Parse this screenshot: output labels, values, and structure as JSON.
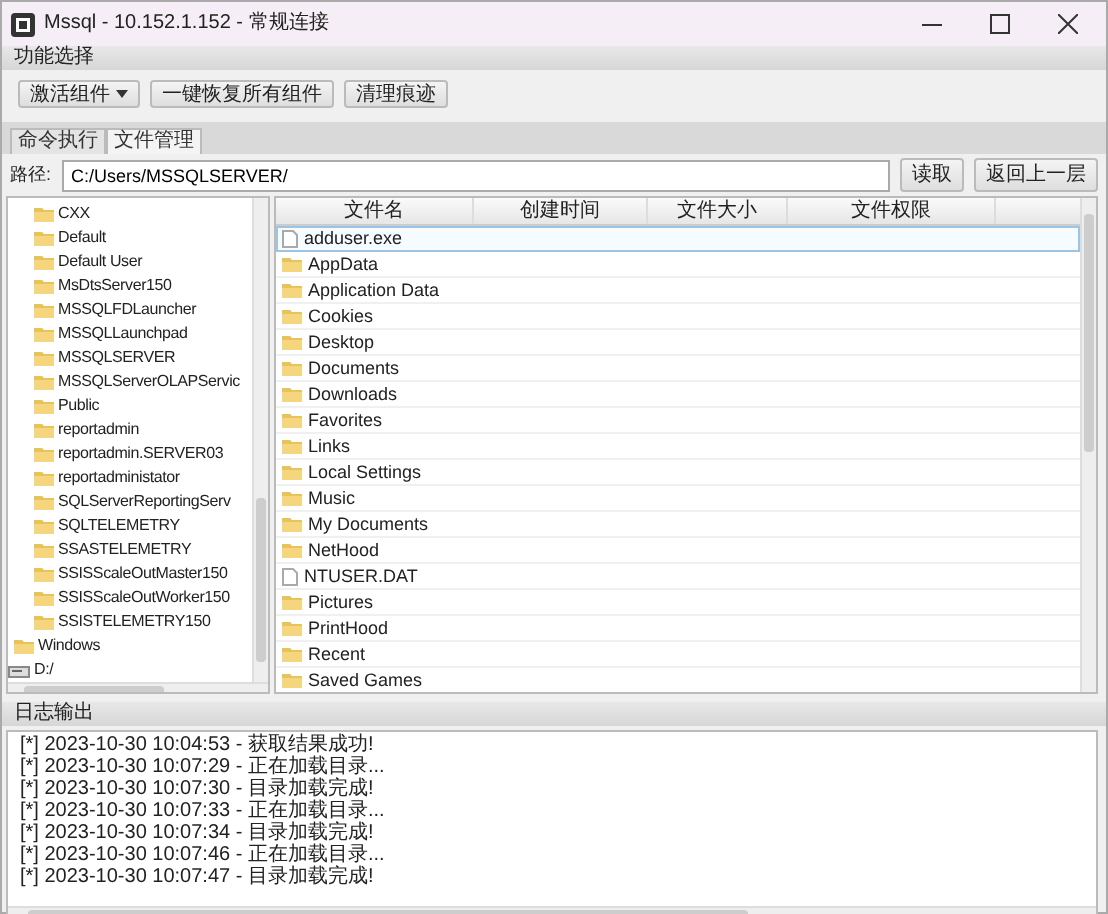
{
  "window": {
    "title": "Mssql - 10.152.1.152 - 常规连接"
  },
  "function_panel": {
    "title": "功能选择",
    "buttons": [
      {
        "label": "激活组件",
        "kind": "dropdown"
      },
      {
        "label": "一键恢复所有组件",
        "kind": "button"
      },
      {
        "label": "清理痕迹",
        "kind": "button"
      }
    ]
  },
  "tabs": [
    {
      "label": "命令执行",
      "selected": false
    },
    {
      "label": "文件管理",
      "selected": true
    }
  ],
  "path_bar": {
    "label": "路径:",
    "value": "C:/Users/MSSQLSERVER/",
    "buttons": [
      "读取",
      "返回上一层"
    ]
  },
  "tree": [
    {
      "children": [
        {
          "children": [
            {
              "label": "CXX",
              "kind": "folder"
            },
            {
              "label": "Default",
              "kind": "folder"
            },
            {
              "label": "Default User",
              "kind": "folder"
            },
            {
              "label": "MsDtsServer150",
              "kind": "folder"
            },
            {
              "label": "MSSQLFDLauncher",
              "kind": "folder"
            },
            {
              "label": "MSSQLLaunchpad",
              "kind": "folder"
            },
            {
              "label": "MSSQLSERVER",
              "kind": "folder"
            },
            {
              "label": "MSSQLServerOLAPServic",
              "kind": "folder"
            },
            {
              "label": "Public",
              "kind": "folder"
            },
            {
              "label": "reportadmin",
              "kind": "folder"
            },
            {
              "label": "reportadmin.SERVER03",
              "kind": "folder"
            },
            {
              "label": "reportadministator",
              "kind": "folder"
            },
            {
              "label": "SQLServerReportingServ",
              "kind": "folder"
            },
            {
              "label": "SQLTELEMETRY",
              "kind": "folder"
            },
            {
              "label": "SSASTELEMETRY",
              "kind": "folder"
            },
            {
              "label": "SSISScaleOutMaster150",
              "kind": "folder"
            },
            {
              "label": "SSISScaleOutWorker150",
              "kind": "folder"
            },
            {
              "label": "SSISTELEMETRY150",
              "kind": "folder"
            }
          ]
        },
        {
          "label": "Windows",
          "kind": "folder"
        }
      ]
    },
    {
      "label": "D:/",
      "kind": "drive"
    }
  ],
  "table": {
    "columns": [
      "文件名",
      "创建时间",
      "文件大小",
      "文件权限"
    ],
    "rows": [
      {
        "name": "adduser.exe",
        "kind": "file",
        "selected": true
      },
      {
        "name": "AppData",
        "kind": "folder",
        "selected": false
      },
      {
        "name": "Application Data",
        "kind": "folder",
        "selected": false
      },
      {
        "name": "Cookies",
        "kind": "folder",
        "selected": false
      },
      {
        "name": "Desktop",
        "kind": "folder",
        "selected": false
      },
      {
        "name": "Documents",
        "kind": "folder",
        "selected": false
      },
      {
        "name": "Downloads",
        "kind": "folder",
        "selected": false
      },
      {
        "name": "Favorites",
        "kind": "folder",
        "selected": false
      },
      {
        "name": "Links",
        "kind": "folder",
        "selected": false
      },
      {
        "name": "Local Settings",
        "kind": "folder",
        "selected": false
      },
      {
        "name": "Music",
        "kind": "folder",
        "selected": false
      },
      {
        "name": "My Documents",
        "kind": "folder",
        "selected": false
      },
      {
        "name": "NetHood",
        "kind": "folder",
        "selected": false
      },
      {
        "name": "NTUSER.DAT",
        "kind": "file",
        "selected": false
      },
      {
        "name": "Pictures",
        "kind": "folder",
        "selected": false
      },
      {
        "name": "PrintHood",
        "kind": "folder",
        "selected": false
      },
      {
        "name": "Recent",
        "kind": "folder",
        "selected": false
      },
      {
        "name": "Saved Games",
        "kind": "folder",
        "selected": false
      }
    ]
  },
  "log": {
    "title": "日志输出",
    "lines": [
      "[*] 2023-10-30 10:04:53 - 获取结果成功!",
      "[*] 2023-10-30 10:07:29 - 正在加载目录...",
      "[*] 2023-10-30 10:07:30 - 目录加载完成!",
      "[*] 2023-10-30 10:07:33 - 正在加载目录...",
      "[*] 2023-10-30 10:07:34 - 目录加载完成!",
      "[*] 2023-10-30 10:07:46 - 正在加载目录...",
      "[*] 2023-10-30 10:07:47 - 目录加载完成!"
    ]
  }
}
